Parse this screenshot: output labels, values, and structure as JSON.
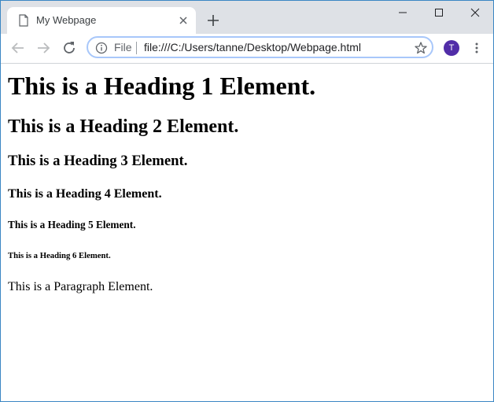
{
  "tab": {
    "title": "My Webpage",
    "page_icon": "page-icon",
    "close_icon": "close-icon"
  },
  "new_tab_icon": "plus-icon",
  "window_controls": {
    "minimize_icon": "minimize-icon",
    "maximize_icon": "maximize-icon",
    "close_icon": "close-icon"
  },
  "toolbar": {
    "back_icon": "arrow-left-icon",
    "forward_icon": "arrow-right-icon",
    "reload_icon": "reload-icon",
    "scheme_label": "File",
    "url": "file:///C:/Users/tanne/Desktop/Webpage.html",
    "bookmark_icon": "star-icon",
    "profile_initial": "T",
    "profile_color": "#512da8",
    "menu_icon": "more-vert-icon"
  },
  "page": {
    "h1": "This is a Heading 1 Element.",
    "h2": "This is a Heading 2 Element.",
    "h3": "This is a Heading 3 Element.",
    "h4": "This is a Heading 4 Element.",
    "h5": "This is a Heading 5 Element.",
    "h6": "This is a Heading 6 Element.",
    "paragraph": "This is a Paragraph Element."
  },
  "colors": {
    "tabstrip_bg": "#dee1e6",
    "window_border": "#3b87c4",
    "omnibox_focus": "#a8c7fa"
  }
}
